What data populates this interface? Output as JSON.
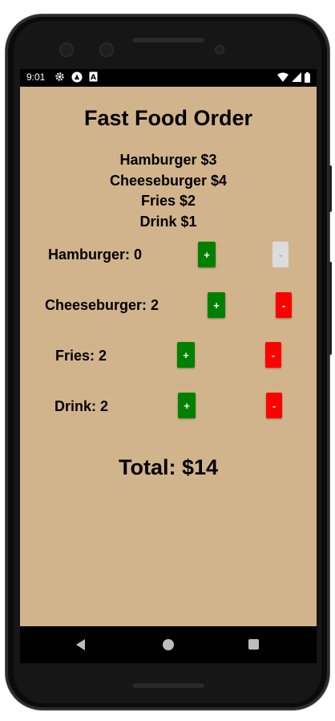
{
  "status_bar": {
    "time": "9:01",
    "left_icons": [
      "gear-icon",
      "react-icon",
      "sim-icon"
    ],
    "right_icons": [
      "wifi-icon",
      "signal-icon",
      "battery-icon"
    ]
  },
  "app": {
    "title": "Fast Food Order",
    "menu": [
      "Hamburger $3",
      "Cheeseburger $4",
      "Fries $2",
      "Drink $1"
    ],
    "items": [
      {
        "label": "Hamburger: 0",
        "plus": "+",
        "minus": "-",
        "minus_enabled": false
      },
      {
        "label": "Cheeseburger: 2",
        "plus": "+",
        "minus": "-",
        "minus_enabled": true
      },
      {
        "label": "Fries: 2",
        "plus": "+",
        "minus": "-",
        "minus_enabled": true
      },
      {
        "label": "Drink: 2",
        "plus": "+",
        "minus": "-",
        "minus_enabled": true
      }
    ],
    "total": "Total: $14"
  },
  "colors": {
    "background": "#d2b48c",
    "plus_button": "#008000",
    "minus_button": "#ff0000",
    "minus_disabled": "#dcdcdc"
  },
  "nav_bar": {
    "icons": [
      "back-icon",
      "home-icon",
      "recents-icon"
    ]
  }
}
